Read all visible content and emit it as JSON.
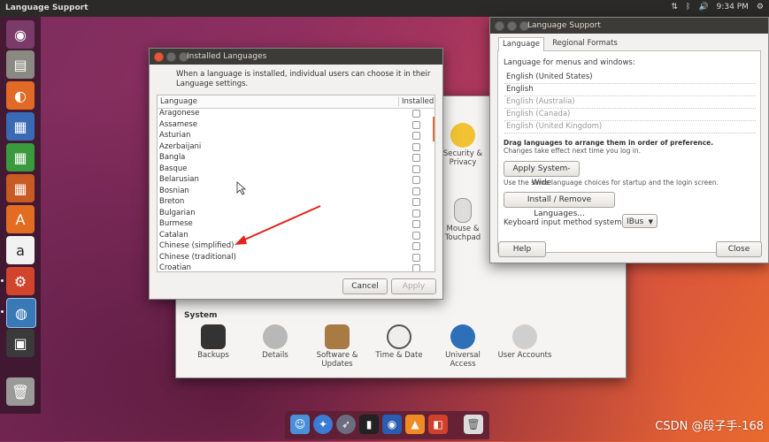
{
  "top_panel": {
    "title": "Language Support",
    "time": "9:34 PM"
  },
  "installed_languages": {
    "title": "Installed Languages",
    "message": "When a language is installed, individual users can choose it in their Language settings.",
    "columns": {
      "language": "Language",
      "installed": "Installed"
    },
    "languages": [
      "Aragonese",
      "Assamese",
      "Asturian",
      "Azerbaijani",
      "Bangla",
      "Basque",
      "Belarusian",
      "Bosnian",
      "Breton",
      "Bulgarian",
      "Burmese",
      "Catalan",
      "Chinese (simplified)",
      "Chinese (traditional)",
      "Croatian"
    ],
    "cancel": "Cancel",
    "apply": "Apply"
  },
  "system_settings": {
    "partial_items": [
      {
        "label": "Security & Privacy",
        "icon": "security-icon"
      },
      {
        "label": "Mouse & Touchpad",
        "icon": "mouse-icon"
      }
    ],
    "system_heading": "System",
    "system_items": [
      {
        "label": "Backups",
        "icon": "backups-icon"
      },
      {
        "label": "Details",
        "icon": "details-gear-icon"
      },
      {
        "label": "Software & Updates",
        "icon": "software-updates-icon"
      },
      {
        "label": "Time & Date",
        "icon": "clock-icon"
      },
      {
        "label": "Universal Access",
        "icon": "universal-access-icon"
      },
      {
        "label": "User Accounts",
        "icon": "user-accounts-icon"
      }
    ]
  },
  "language_support": {
    "title": "Language Support",
    "tabs": [
      "Language",
      "Regional Formats"
    ],
    "menus_label": "Language for menus and windows:",
    "languages": [
      {
        "name": "English (United States)",
        "active": true
      },
      {
        "name": "English",
        "active": true
      },
      {
        "name": "English (Australia)",
        "active": false
      },
      {
        "name": "English (Canada)",
        "active": false
      },
      {
        "name": "English (United Kingdom)",
        "active": false
      }
    ],
    "drag_hint": "Drag languages to arrange them in order of preference.",
    "drag_sub": "Changes take effect next time you log in.",
    "apply_system_wide": "Apply System-Wide",
    "same_choices": "Use the same language choices for startup and the login screen.",
    "install_remove": "Install / Remove Languages...",
    "keyboard_label": "Keyboard input method system:",
    "keyboard_value": "IBus",
    "help": "Help",
    "close": "Close"
  },
  "watermark": "CSDN @段子手-168"
}
